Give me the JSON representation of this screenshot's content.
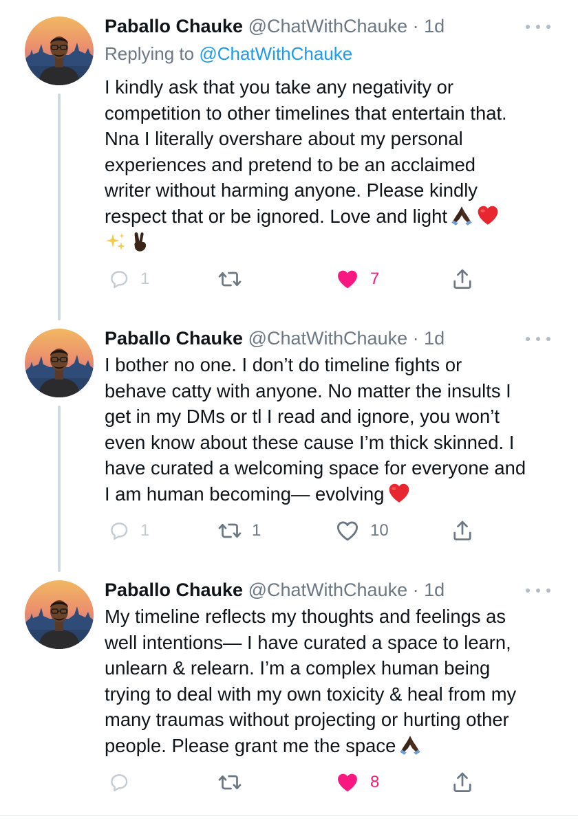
{
  "colors": {
    "text": "#0f1419",
    "secondary": "#6b7783",
    "link": "#1d9bf0",
    "like": "#f91880",
    "thread_line": "#cfd9de"
  },
  "tweets": [
    {
      "author_name": "Paballo Chauke",
      "handle": "@ChatWithChauke",
      "separator": "·",
      "time": "1d",
      "replying_label": "Replying to",
      "replying_to": "@ChatWithChauke",
      "lines": [
        "I kindly ask that you take any negativity or",
        "competition to other timelines that entertain that.",
        "Nna I literally overshare about my personal",
        "experiences and pretend to be an acclaimed",
        "writer without harming anyone. Please kindly",
        "respect that or be ignored. Love and light"
      ],
      "emojis": [
        "folded-hands-icon",
        "red-heart-icon",
        "sparkles-icon",
        "victory-hand-icon"
      ],
      "reply_count": "1",
      "retweet_count": "",
      "like_count": "7",
      "liked": true
    },
    {
      "author_name": "Paballo Chauke",
      "handle": "@ChatWithChauke",
      "separator": "·",
      "time": "1d",
      "lines": [
        "I bother no one. I don’t do timeline fights or",
        "behave catty with anyone. No matter the insults I",
        "get in my DMs or tl I read and ignore, you won’t",
        "even know about these cause I’m thick skinned. I",
        "have curated a welcoming space for everyone and",
        "I am human becoming— evolving"
      ],
      "emojis": [
        "red-heart-icon"
      ],
      "reply_count": "1",
      "retweet_count": "1",
      "like_count": "10",
      "liked": false
    },
    {
      "author_name": "Paballo Chauke",
      "handle": "@ChatWithChauke",
      "separator": "·",
      "time": "1d",
      "lines": [
        "My timeline reflects my thoughts and feelings as",
        "well intentions— I have curated a space to learn,",
        "unlearn & relearn. I’m a complex human being",
        "trying to deal with my own toxicity & heal from my",
        "many traumas without projecting or hurting other",
        "people. Please grant me the space"
      ],
      "emojis": [
        "folded-hands-icon"
      ],
      "reply_count": "",
      "retweet_count": "",
      "like_count": "8",
      "liked": true
    }
  ]
}
